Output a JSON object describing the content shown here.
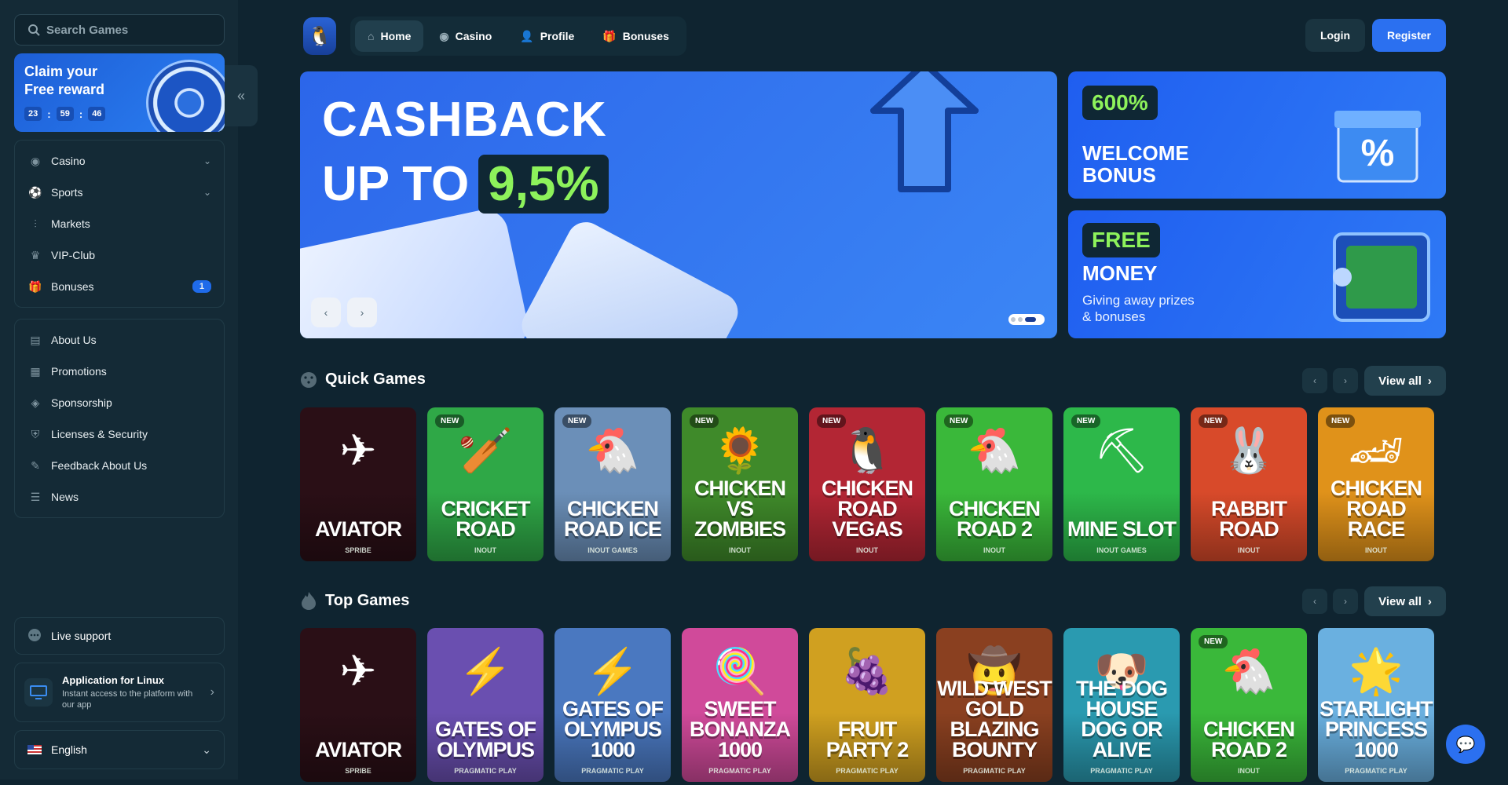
{
  "search": {
    "placeholder": "Search Games"
  },
  "promo": {
    "title": "Claim your Free reward",
    "timer": [
      "23",
      "59",
      "46"
    ],
    "sep": ":"
  },
  "sidebar": {
    "nav": [
      {
        "label": "Casino",
        "icon": "casino-icon",
        "expandable": true
      },
      {
        "label": "Sports",
        "icon": "sports-icon",
        "expandable": true
      },
      {
        "label": "Markets",
        "icon": "markets-icon"
      },
      {
        "label": "VIP-Club",
        "icon": "crown-icon"
      },
      {
        "label": "Bonuses",
        "icon": "gift-icon",
        "badge": "1"
      }
    ],
    "info": [
      {
        "label": "About Us",
        "icon": "book-icon"
      },
      {
        "label": "Promotions",
        "icon": "promotions-icon"
      },
      {
        "label": "Sponsorship",
        "icon": "sponsorship-icon"
      },
      {
        "label": "Licenses & Security",
        "icon": "shield-icon"
      },
      {
        "label": "Feedback About Us",
        "icon": "feedback-icon"
      },
      {
        "label": "News",
        "icon": "news-icon"
      }
    ],
    "live_support": "Live support",
    "app": {
      "title": "Application for Linux",
      "subtitle": "Instant access to the platform with our app"
    },
    "language": "English"
  },
  "topnav": {
    "items": [
      "Home",
      "Casino",
      "Profile",
      "Bonuses"
    ],
    "active": "Home"
  },
  "auth": {
    "login": "Login",
    "register": "Register"
  },
  "hero": {
    "line1": "CASHBACK",
    "line2": "UP TO",
    "highlight": "9,5%"
  },
  "banners": {
    "welcome": {
      "pill": "600%",
      "title": "WELCOME BONUS"
    },
    "free": {
      "pill": "FREE",
      "title": "MONEY",
      "subtitle": "Giving away prizes & bonuses"
    }
  },
  "quick_games": {
    "title": "Quick Games",
    "view_all": "View all",
    "games": [
      {
        "name": "AVIATOR",
        "provider": "SPRIBE",
        "new": false,
        "bg": "#2a0f16",
        "art": "✈"
      },
      {
        "name": "CRICKET ROAD",
        "provider": "INOUT",
        "new": true,
        "bg": "#2fa847",
        "art": "🏏"
      },
      {
        "name": "CHICKEN ROAD ICE",
        "provider": "INOUT GAMES",
        "new": true,
        "bg": "#6b8fb8",
        "art": "🐔"
      },
      {
        "name": "CHICKEN VS ZOMBIES",
        "provider": "INOUT",
        "new": true,
        "bg": "#3f8a2a",
        "art": "🌻"
      },
      {
        "name": "CHICKEN ROAD VEGAS",
        "provider": "INOUT",
        "new": true,
        "bg": "#b32634",
        "art": "🐧"
      },
      {
        "name": "CHICKEN ROAD 2",
        "provider": "INOUT",
        "new": true,
        "bg": "#3ab83a",
        "art": "🐔"
      },
      {
        "name": "MINE SLOT",
        "provider": "INOUT GAMES",
        "new": true,
        "bg": "#2db84a",
        "art": "⛏"
      },
      {
        "name": "RABBIT ROAD",
        "provider": "INOUT",
        "new": true,
        "bg": "#d84a2a",
        "art": "🐰"
      },
      {
        "name": "CHICKEN ROAD RACE",
        "provider": "INOUT",
        "new": true,
        "bg": "#e0921a",
        "art": "🏎"
      }
    ]
  },
  "top_games": {
    "title": "Top Games",
    "view_all": "View all",
    "games": [
      {
        "name": "AVIATOR",
        "provider": "SPRIBE",
        "new": false,
        "bg": "#2a0f16",
        "art": "✈"
      },
      {
        "name": "GATES OF OLYMPUS",
        "provider": "PRAGMATIC PLAY",
        "new": false,
        "bg": "#6a4fb0",
        "art": "⚡"
      },
      {
        "name": "GATES OF OLYMPUS 1000",
        "provider": "PRAGMATIC PLAY",
        "new": false,
        "bg": "#4a78c0",
        "art": "⚡"
      },
      {
        "name": "SWEET BONANZA 1000",
        "provider": "PRAGMATIC PLAY",
        "new": false,
        "bg": "#d04a9a",
        "art": "🍭"
      },
      {
        "name": "FRUIT PARTY 2",
        "provider": "PRAGMATIC PLAY",
        "new": false,
        "bg": "#d0a020",
        "art": "🍇"
      },
      {
        "name": "WILD WEST GOLD BLAZING BOUNTY",
        "provider": "PRAGMATIC PLAY",
        "new": false,
        "bg": "#8a4020",
        "art": "🤠"
      },
      {
        "name": "THE DOG HOUSE DOG OR ALIVE",
        "provider": "PRAGMATIC PLAY",
        "new": false,
        "bg": "#2a9ab0",
        "art": "🐶"
      },
      {
        "name": "CHICKEN ROAD 2",
        "provider": "INOUT",
        "new": true,
        "bg": "#3ab83a",
        "art": "🐔"
      },
      {
        "name": "STARLIGHT PRINCESS 1000",
        "provider": "PRAGMATIC PLAY",
        "new": false,
        "bg": "#6ab0e0",
        "art": "🌟"
      }
    ]
  },
  "new_label": "NEW",
  "colors": {
    "accent": "#2b70f0",
    "highlight": "#8df25b",
    "bg": "#0f2430",
    "sidebar": "#142a36"
  }
}
